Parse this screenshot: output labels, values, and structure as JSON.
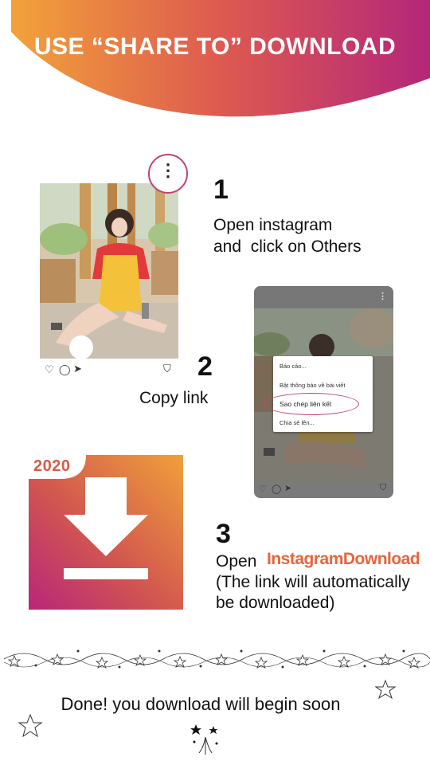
{
  "header": {
    "title": "USE “SHARE TO” DOWNLOAD"
  },
  "step1": {
    "number": "1",
    "line1": "Open instagram",
    "line2": "and  click on Others"
  },
  "step2": {
    "number": "2",
    "text": "Copy link"
  },
  "step3": {
    "number": "3",
    "open_label": "Open",
    "brand": "InstagramDownload",
    "line2": "(The link will automatically",
    "line3": "be downloaded)"
  },
  "phone_menu": {
    "items": [
      "Báo cáo...",
      "Bật thông báo về bài viết",
      "Sao chép liên kết",
      "Chia sẻ lên..."
    ]
  },
  "app_icon": {
    "year": "2020"
  },
  "footer": {
    "text": "Done! you download will begin soon"
  },
  "icons": {
    "more": "more-vertical-icon",
    "heart": "heart-icon",
    "comment": "comment-icon",
    "share": "send-icon",
    "bookmark": "bookmark-icon",
    "download": "download-arrow-icon"
  },
  "colors": {
    "orange": "#f0a03a",
    "magenta": "#b8267a",
    "pink_accent": "#c0436e",
    "brand_orange": "#e8643b"
  }
}
